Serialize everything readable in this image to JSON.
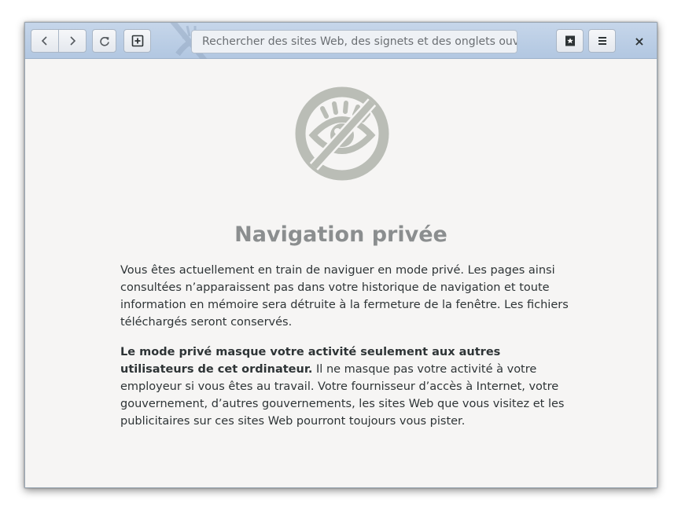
{
  "header": {
    "back_icon": "chevron-left-icon",
    "forward_icon": "chevron-right-icon",
    "reload_icon": "reload-icon",
    "new_tab_icon": "new-tab-icon",
    "search_placeholder": "Rechercher des sites Web, des signets et des onglets ouverts",
    "search_value": "",
    "bookmarks_icon": "bookmark-star-icon",
    "menu_icon": "hamburger-menu-icon",
    "close_label": "×"
  },
  "content": {
    "icon": "private-eye-crossed-icon",
    "title": "Navigation privée",
    "paragraph1": "Vous êtes actuellement en train de naviguer en mode privé. Les pages ainsi consultées n’apparaissent pas dans votre historique de navigation et toute information en mémoire sera détruite à la fermeture de la fenêtre. Les fichiers téléchargés seront conservés.",
    "paragraph2_bold": "Le mode privé masque votre activité seulement aux autres utilisateurs de cet ordinateur.",
    "paragraph2_rest": " Il ne masque pas votre activité à votre employeur si vous êtes au travail. Votre fournisseur d’accès à Internet, votre gouvernement, d’autres gouvernements, les sites Web que vous visitez et les publicitaires sur ces sites Web pourront toujours vous pister."
  },
  "colors": {
    "headerbar": "#b8cbe3",
    "content_bg": "#f6f5f4",
    "icon_gray": "#babdb6",
    "title_gray": "#8b8e8f",
    "text": "#2e3436"
  }
}
